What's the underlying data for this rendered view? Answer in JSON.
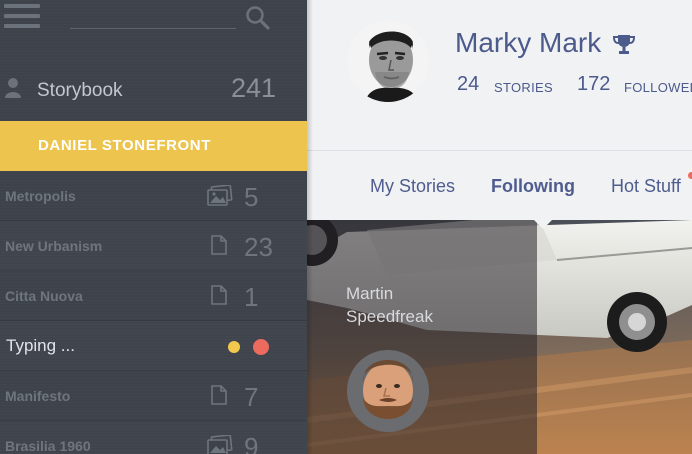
{
  "sidebar": {
    "story_label": "Storybook",
    "story_count": "241",
    "active_user": "DANIEL STONEFRONT",
    "items": [
      {
        "label": "Metropolis",
        "icon": "image-icon",
        "count": "5"
      },
      {
        "label": "New Urbanism",
        "icon": "document-icon",
        "count": "23"
      },
      {
        "label": "Citta Nuova",
        "icon": "document-icon",
        "count": "1"
      },
      {
        "label": "Manifesto",
        "icon": "document-icon",
        "count": "7"
      },
      {
        "label": "Brasilia 1960",
        "icon": "image-icon",
        "count": "9"
      }
    ],
    "typing_label": "Typing ...",
    "typing_dot_colors": [
      "#f2c94c",
      "#ec6a5e"
    ]
  },
  "profile": {
    "name": "Marky Mark",
    "stories_count": "24",
    "stories_label": "STORIES",
    "followers_count": "172",
    "followers_label": "FOLLOWERS"
  },
  "tabs": [
    {
      "label": "My Stories",
      "active": false
    },
    {
      "label": "Following",
      "active": true
    },
    {
      "label": "Hot Stuff",
      "active": false
    }
  ],
  "feed_card": {
    "author_name": "Martin Speedfreak"
  },
  "colors": {
    "accent_yellow": "#ecc44e",
    "sidebar_bg": "#3d424b",
    "brand_blue": "#4c5a8c",
    "notification": "#ec6a5e"
  }
}
